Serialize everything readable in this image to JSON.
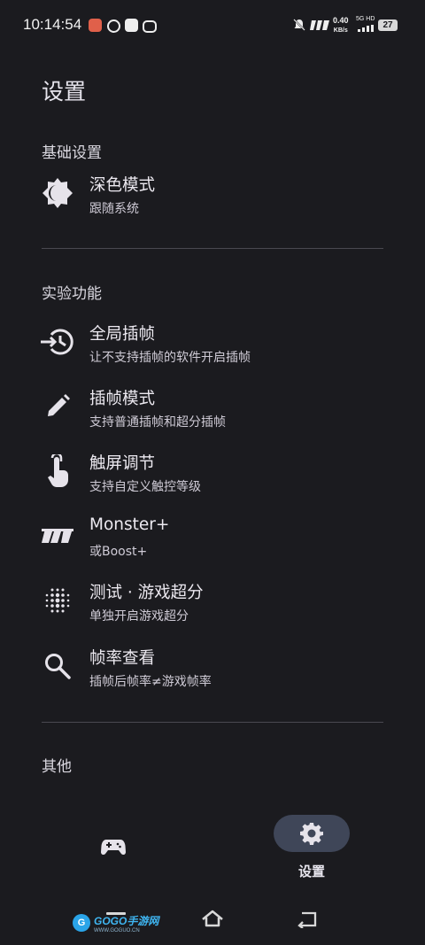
{
  "status_bar": {
    "time": "10:14:54",
    "net_speed_value": "0.40",
    "net_speed_unit": "KB/s",
    "signal": "5G HD",
    "battery": "27"
  },
  "page_title": "设置",
  "sections": [
    {
      "header": "基础设置",
      "items": [
        {
          "title": "深色模式",
          "subtitle": "跟随系统",
          "icon": "dark-mode-icon"
        }
      ]
    },
    {
      "header": "实验功能",
      "items": [
        {
          "title": "全局插帧",
          "subtitle": "让不支持插帧的软件开启插帧",
          "icon": "global-interpolation-icon"
        },
        {
          "title": "插帧模式",
          "subtitle": "支持普通插帧和超分插帧",
          "icon": "pencil-icon"
        },
        {
          "title": "触屏调节",
          "subtitle": "支持自定义触控等级",
          "icon": "touch-icon"
        },
        {
          "title": "Monster+",
          "subtitle": "或Boost+",
          "icon": "monster-logo-icon"
        },
        {
          "title": "测试 · 游戏超分",
          "subtitle": "单独开启游戏超分",
          "icon": "dots-grid-icon"
        },
        {
          "title": "帧率查看",
          "subtitle": "插帧后帧率≠游戏帧率",
          "icon": "search-icon"
        }
      ]
    },
    {
      "header": "其他",
      "items": []
    }
  ],
  "bottom_nav": {
    "items": [
      {
        "label": "",
        "icon": "gamepad-icon",
        "active": false
      },
      {
        "label": "设置",
        "icon": "gear-icon",
        "active": true
      }
    ]
  },
  "watermark": {
    "logo": "G",
    "text": "GOGO手游网",
    "sub": "WWW.GOGUO.CN"
  },
  "colors": {
    "background": "#1b1b1f",
    "active_pill": "#3f4658",
    "divider": "#4a4850"
  }
}
